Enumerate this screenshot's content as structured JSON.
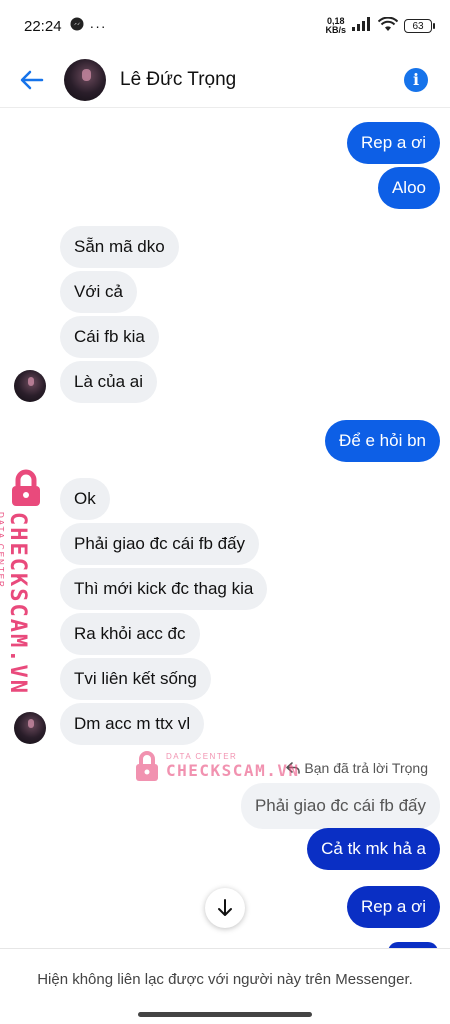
{
  "status_bar": {
    "time": "22:24",
    "more": "···",
    "speed_value": "0,18",
    "speed_unit": "KB/s",
    "battery": "63"
  },
  "header": {
    "contact_name": "Lê Đức Trọng"
  },
  "messages": [
    {
      "from": "me",
      "text": "Rep a ơi"
    },
    {
      "from": "me",
      "text": "Aloo"
    },
    {
      "from": "contact",
      "text": "Sẵn mã dko"
    },
    {
      "from": "contact",
      "text": "Với cả"
    },
    {
      "from": "contact",
      "text": "Cái fb kia"
    },
    {
      "from": "contact",
      "text": "Là của ai"
    },
    {
      "from": "me",
      "text": "Để e hỏi bn"
    },
    {
      "from": "contact",
      "text": "Ok"
    },
    {
      "from": "contact",
      "text": "Phải giao đc cái fb đấy"
    },
    {
      "from": "contact",
      "text": "Thì mới kick đc thag kia"
    },
    {
      "from": "contact",
      "text": "Ra khỏi acc đc"
    },
    {
      "from": "contact",
      "text": "Tvi liên kết sống"
    },
    {
      "from": "contact",
      "text": "Dm acc m ttx vl"
    },
    {
      "from": "me",
      "text": "Cả tk mk hả a"
    },
    {
      "from": "me",
      "text": "Rep a ơi"
    }
  ],
  "reply": {
    "note": "Bạn đã trả lời Trọng",
    "quoted_text": "Phải giao đc cái fb đấy"
  },
  "watermark": {
    "label_small": "DATA CENTER",
    "label_big": "CHECKSCAM.VN"
  },
  "footer": {
    "note": "Hiện không liên lạc được với người này trên Messenger."
  },
  "colors": {
    "sent_bubble": "#0d5fe6",
    "sent_bubble_dark": "#0a2fc4",
    "received_bubble": "#eef0f3",
    "accent": "#1673ea",
    "watermark": "#e94a7c"
  }
}
